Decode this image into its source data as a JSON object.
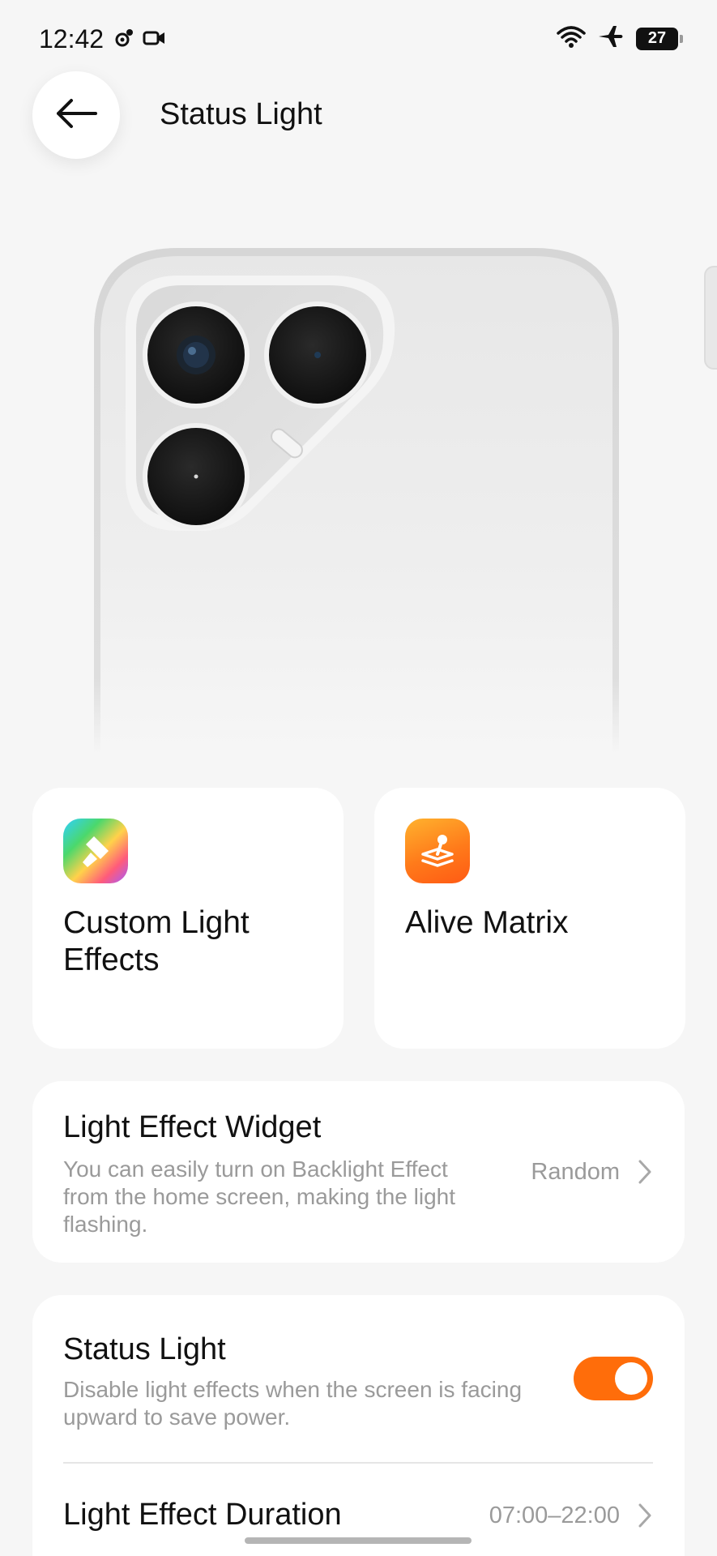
{
  "status_bar": {
    "time": "12:42",
    "battery": "27",
    "icons": [
      "gear-badge-icon",
      "video-camera-icon",
      "wifi-icon",
      "airplane-icon",
      "battery-icon"
    ]
  },
  "header": {
    "title": "Status Light",
    "back_icon": "arrow-left-icon"
  },
  "illustration": {
    "subject": "phone-back-with-camera-module"
  },
  "feature_tiles": [
    {
      "label": "Custom Light Effects",
      "icon": "paint-brush-icon"
    },
    {
      "label": "Alive Matrix",
      "icon": "alive-matrix-icon"
    }
  ],
  "widget_row": {
    "title": "Light Effect Widget",
    "description": "You can easily turn on Backlight Effect from the home screen, making the light flashing.",
    "value": "Random"
  },
  "status_row": {
    "title": "Status Light",
    "description": "Disable light effects when the screen is facing upward to save power.",
    "enabled": true
  },
  "duration_row": {
    "title": "Light Effect Duration",
    "value": "07:00–22:00"
  },
  "colors": {
    "accent": "#ff6d0a",
    "background": "#f6f6f6",
    "card": "#ffffff",
    "secondary_text": "#9a9a9a"
  }
}
